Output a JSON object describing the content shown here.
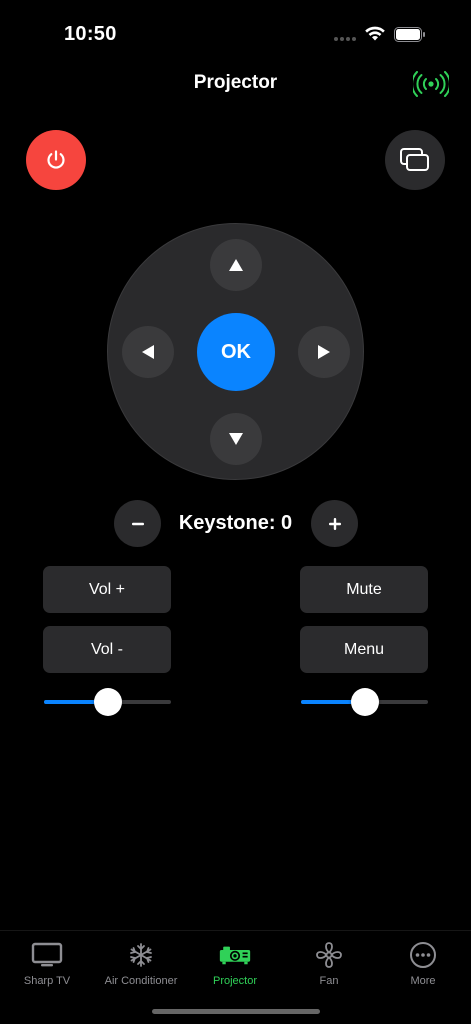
{
  "status_bar": {
    "time": "10:50"
  },
  "nav": {
    "title": "Projector"
  },
  "colors": {
    "power": "#f6453e",
    "accent": "#0a84ff",
    "active_tab": "#30d158",
    "button_bg": "#2b2b2d"
  },
  "icons": {
    "power": "power-icon",
    "source": "input-source-icon",
    "connection": "broadcast-icon"
  },
  "dpad": {
    "ok_label": "OK"
  },
  "keystone": {
    "label": "Keystone: 0",
    "minus": "−",
    "plus": "+"
  },
  "buttons": {
    "vol_up": "Vol +",
    "vol_down": "Vol -",
    "mute": "Mute",
    "menu": "Menu"
  },
  "sliders": {
    "left_value": 0.5,
    "right_value": 0.5
  },
  "tabs": [
    {
      "label": "Sharp TV",
      "icon": "tv-icon",
      "active": false
    },
    {
      "label": "Air Conditioner",
      "icon": "snowflake-icon",
      "active": false
    },
    {
      "label": "Projector",
      "icon": "projector-icon",
      "active": true
    },
    {
      "label": "Fan",
      "icon": "fan-icon",
      "active": false
    },
    {
      "label": "More",
      "icon": "more-icon",
      "active": false
    }
  ]
}
